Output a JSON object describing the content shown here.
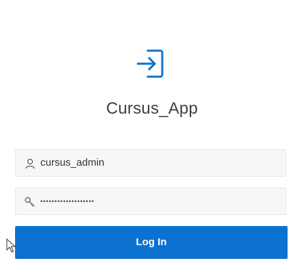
{
  "app": {
    "title": "Cursus_App",
    "icon": "sign-in-icon",
    "accent_color": "#0b72d1"
  },
  "form": {
    "username": {
      "value": "cursus_admin",
      "icon": "user-icon"
    },
    "password": {
      "masked_value": "•••••••••••••••••••",
      "icon": "key-icon"
    },
    "submit_label": "Log In"
  },
  "cursor": {
    "icon": "mouse-pointer-icon"
  }
}
